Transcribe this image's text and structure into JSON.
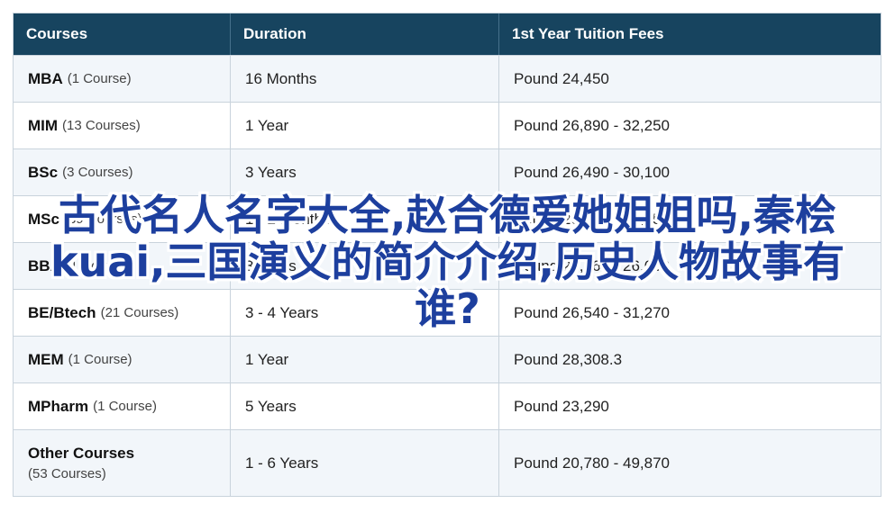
{
  "table": {
    "headers": [
      "Courses",
      "Duration",
      "1st Year Tuition Fees"
    ],
    "rows": [
      {
        "name": "MBA",
        "count": "(1 Course)",
        "duration": "16 Months",
        "fees": "Pound 24,450"
      },
      {
        "name": "MIM",
        "count": "(13 Courses)",
        "duration": "1 Year",
        "fees": "Pound 26,890 - 32,250"
      },
      {
        "name": "BSc",
        "count": "(3 Courses)",
        "duration": "3 Years",
        "fees": "Pound 26,490 - 30,100"
      },
      {
        "name": "MSc",
        "count": "(39 Courses)",
        "duration": "1 - 2 Months",
        "fees": "Pound 26,490 - 39,250"
      },
      {
        "name": "BBA",
        "count": "(1 Course)",
        "duration": "3 Years",
        "fees": "Pound 23,260 - 26,650"
      },
      {
        "name": "BE/Btech",
        "count": "(21 Courses)",
        "duration": "3 - 4 Years",
        "fees": "Pound 26,540 - 31,270"
      },
      {
        "name": "MEM",
        "count": "(1 Course)",
        "duration": "1 Year",
        "fees": "Pound 28,308.3"
      },
      {
        "name": "MPharm",
        "count": "(1 Course)",
        "duration": "5 Years",
        "fees": "Pound 23,290"
      },
      {
        "name": "Other Courses",
        "count": "(53 Courses)",
        "duration": "1 - 6 Years",
        "fees": "Pound 20,780 - 49,870"
      }
    ]
  },
  "overlay": {
    "text": "古代名人名字大全,赵合德爱她姐姐吗,秦桧kuai,三国演义的简介介绍,历史人物故事有谁?"
  }
}
